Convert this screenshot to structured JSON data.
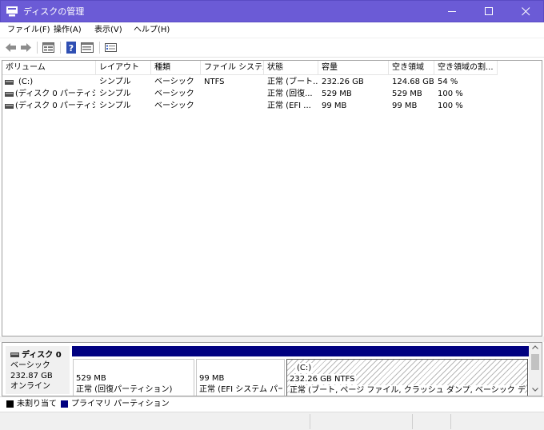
{
  "window": {
    "title": "ディスクの管理"
  },
  "menu": [
    "ファイル(F)",
    "操作(A)",
    "表示(V)",
    "ヘルプ(H)"
  ],
  "toolbar": {
    "icons": [
      "back-arrow-icon",
      "forward-arrow-icon",
      "disk-list-icon",
      "help-icon",
      "properties-icon",
      "settings-icon"
    ]
  },
  "volume_table": {
    "columns": [
      "ボリューム",
      "レイアウト",
      "種類",
      "ファイル システム",
      "状態",
      "容量",
      "空き領域",
      "空き領域の割..."
    ],
    "rows": [
      [
        "(C:)",
        "シンプル",
        "ベーシック",
        "NTFS",
        "正常 (ブート...",
        "232.26 GB",
        "124.68 GB",
        "54 %"
      ],
      [
        "(ディスク 0 パーティシ...",
        "シンプル",
        "ベーシック",
        "",
        "正常 (回復...",
        "529 MB",
        "529 MB",
        "100 %"
      ],
      [
        "(ディスク 0 パーティシ...",
        "シンプル",
        "ベーシック",
        "",
        "正常 (EFI ...",
        "99 MB",
        "99 MB",
        "100 %"
      ]
    ]
  },
  "disk": {
    "name": "ディスク 0",
    "type": "ベーシック",
    "size": "232.87 GB",
    "status": "オンライン",
    "partitions": [
      {
        "label": "",
        "size": "529 MB",
        "status": "正常 (回復パーティション)"
      },
      {
        "label": "",
        "size": "99 MB",
        "status": "正常 (EFI システム パーティション)"
      },
      {
        "label": "(C:)",
        "size": "232.26 GB NTFS",
        "status": "正常 (ブート, ページ ファイル, クラッシュ ダンプ, ベーシック データ パーティション)"
      }
    ]
  },
  "legend": [
    {
      "label": "未割り当て",
      "color": "#000000"
    },
    {
      "label": "プライマリ パーティション",
      "color": "#000080"
    }
  ],
  "colors": {
    "titlebar": "#6b5bd6",
    "primary_partition": "#000080"
  }
}
